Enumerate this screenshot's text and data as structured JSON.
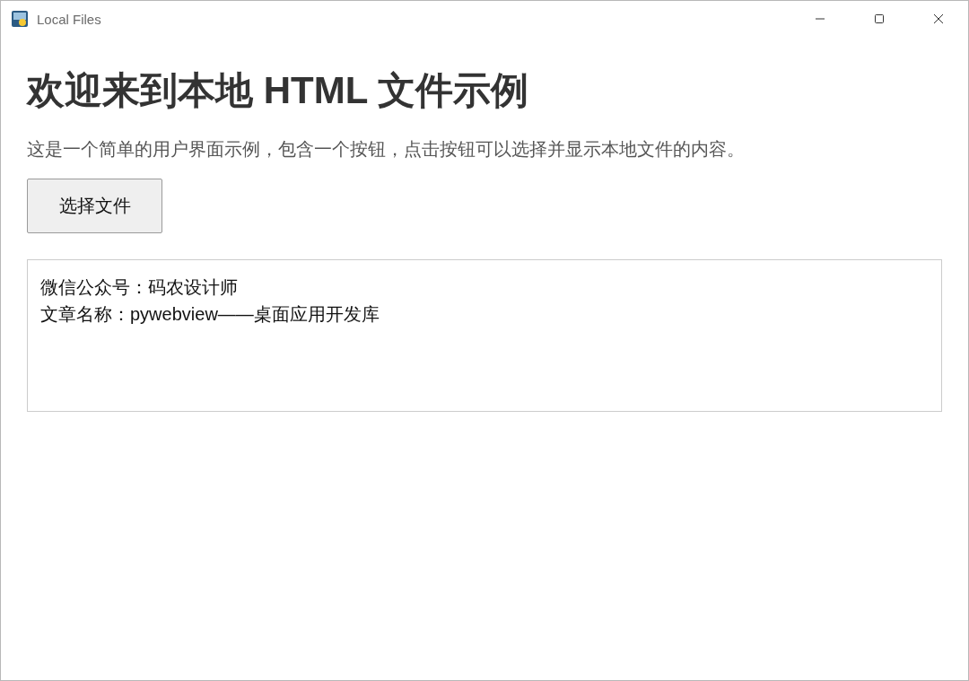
{
  "window": {
    "title": "Local Files"
  },
  "heading": "欢迎来到本地 HTML 文件示例",
  "description": "这是一个简单的用户界面示例，包含一个按钮，点击按钮可以选择并显示本地文件的内容。",
  "button": {
    "label": "选择文件"
  },
  "output": {
    "lines": [
      "微信公众号：码农设计师",
      "文章名称：pywebview——桌面应用开发库"
    ]
  }
}
